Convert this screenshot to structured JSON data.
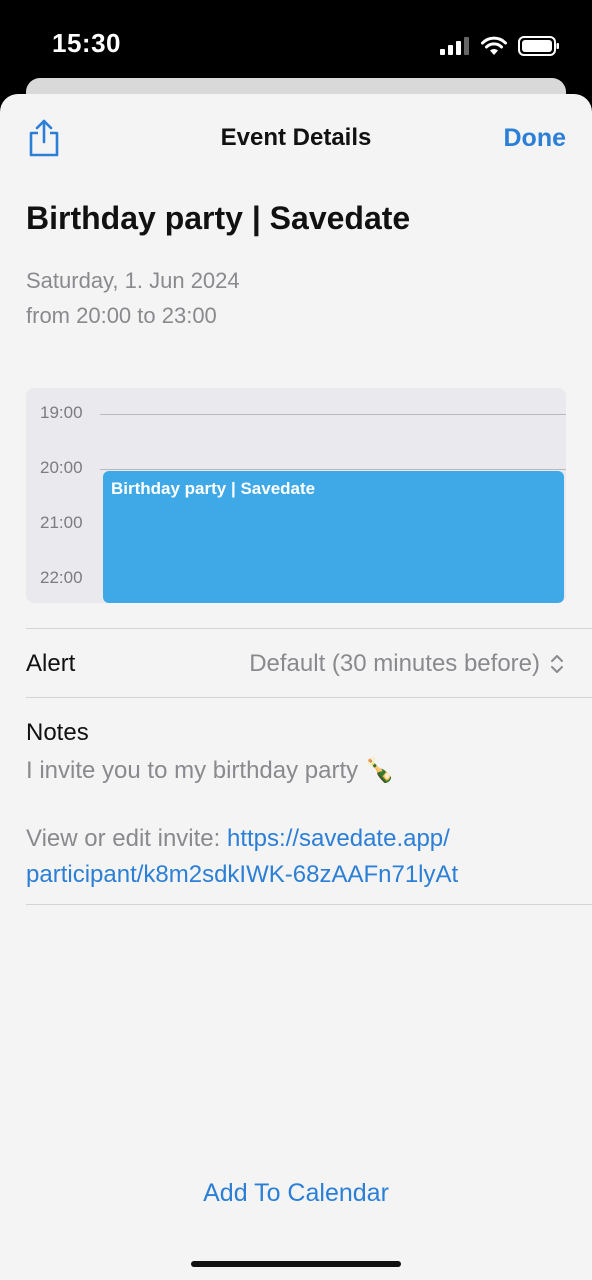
{
  "status_bar": {
    "time": "15:30"
  },
  "nav": {
    "title": "Event Details",
    "done_label": "Done"
  },
  "event": {
    "title": "Birthday party | Savedate",
    "date": "Saturday, 1. Jun 2024",
    "time_range": "from 20:00 to 23:00"
  },
  "timeline": {
    "hours": [
      "19:00",
      "20:00",
      "21:00",
      "22:00"
    ],
    "event_label": "Birthday party | Savedate",
    "event_color": "#3fa9e8"
  },
  "alert": {
    "label": "Alert",
    "value": "Default (30 minutes before)"
  },
  "notes": {
    "label": "Notes",
    "text": "I invite you to my birthday party 🍾",
    "invite_prefix": "View or edit invite: ",
    "invite_link_part1": "https://savedate.app/",
    "invite_link_part2": "participant/k8m2sdkIWK-68zAAFn71lyAt"
  },
  "footer": {
    "add_label": "Add To Calendar"
  },
  "colors": {
    "accent": "#2b7fd6",
    "secondary_text": "#8a8a8e"
  }
}
